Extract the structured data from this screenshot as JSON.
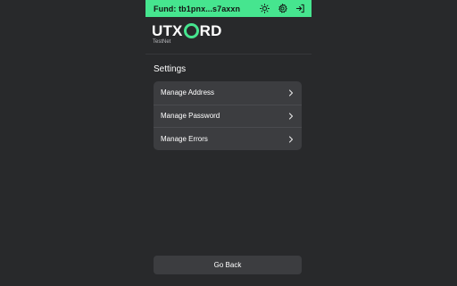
{
  "header": {
    "fund_label": "Fund: tb1pnx...s7axxn",
    "icons": [
      "sun-icon",
      "gear-icon",
      "sign-in-icon"
    ]
  },
  "brand": {
    "logo_prefix": "UTX",
    "logo_suffix": "RD",
    "network": "TestNet"
  },
  "settings": {
    "title": "Settings",
    "items": [
      {
        "label": "Manage Address",
        "icon": "chevron-right-icon"
      },
      {
        "label": "Manage Password",
        "icon": "chevron-right-icon"
      },
      {
        "label": "Manage Errors",
        "icon": "chevron-right-icon"
      }
    ]
  },
  "footer": {
    "go_back_label": "Go Back"
  },
  "colors": {
    "accent": "#46e58f",
    "background": "#28292b",
    "surface": "#3c3d40"
  }
}
